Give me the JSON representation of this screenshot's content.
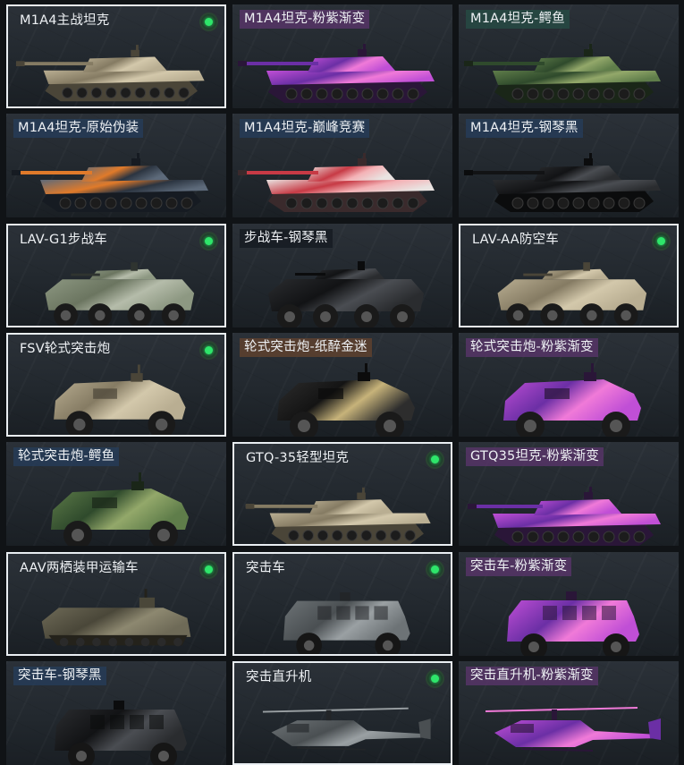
{
  "vehicles": [
    {
      "name": "M1A4主战坦克",
      "tag": "none",
      "selected": true,
      "owned": true,
      "kind": "tank",
      "skin": "desert"
    },
    {
      "name": "M1A4坦克-粉紫渐变",
      "tag": "purple",
      "selected": false,
      "owned": false,
      "kind": "tank",
      "skin": "pinkpurple"
    },
    {
      "name": "M1A4坦克-鳄鱼",
      "tag": "teal",
      "selected": false,
      "owned": false,
      "kind": "tank",
      "skin": "crocodile"
    },
    {
      "name": "M1A4坦克-原始伪装",
      "tag": "navy",
      "selected": false,
      "owned": false,
      "kind": "tank",
      "skin": "orangecamo"
    },
    {
      "name": "M1A4坦克-巅峰竞赛",
      "tag": "navy",
      "selected": false,
      "owned": false,
      "kind": "tank",
      "skin": "redwhite"
    },
    {
      "name": "M1A4坦克-钢琴黑",
      "tag": "navy",
      "selected": false,
      "owned": false,
      "kind": "tank",
      "skin": "black"
    },
    {
      "name": "LAV-G1步战车",
      "tag": "none",
      "selected": true,
      "owned": true,
      "kind": "ifv",
      "skin": "green"
    },
    {
      "name": "步战车-钢琴黑",
      "tag": "dark",
      "selected": false,
      "owned": false,
      "kind": "ifv",
      "skin": "black"
    },
    {
      "name": "LAV-AA防空车",
      "tag": "none",
      "selected": true,
      "owned": true,
      "kind": "ifv",
      "skin": "desert"
    },
    {
      "name": "FSV轮式突击炮",
      "tag": "none",
      "selected": true,
      "owned": true,
      "kind": "armored",
      "skin": "desert"
    },
    {
      "name": "轮式突击炮-纸醉金迷",
      "tag": "brown",
      "selected": false,
      "owned": false,
      "kind": "armored",
      "skin": "blackgold"
    },
    {
      "name": "轮式突击炮-粉紫渐变",
      "tag": "purple",
      "selected": false,
      "owned": false,
      "kind": "armored",
      "skin": "pinkpurple"
    },
    {
      "name": "轮式突击炮-鳄鱼",
      "tag": "navy",
      "selected": false,
      "owned": false,
      "kind": "armored",
      "skin": "crocodile"
    },
    {
      "name": "GTQ-35轻型坦克",
      "tag": "none",
      "selected": true,
      "owned": true,
      "kind": "lighttank",
      "skin": "desert"
    },
    {
      "name": "GTQ35坦克-粉紫渐变",
      "tag": "purple",
      "selected": false,
      "owned": false,
      "kind": "lighttank",
      "skin": "pinkpurple"
    },
    {
      "name": "AAV两栖装甲运输车",
      "tag": "none",
      "selected": true,
      "owned": true,
      "kind": "aav",
      "skin": "olive"
    },
    {
      "name": "突击车",
      "tag": "none",
      "selected": true,
      "owned": true,
      "kind": "assault",
      "skin": "grey"
    },
    {
      "name": "突击车-粉紫渐变",
      "tag": "purple",
      "selected": false,
      "owned": false,
      "kind": "assault",
      "skin": "pinkpurple"
    },
    {
      "name": "突击车-钢琴黑",
      "tag": "navy",
      "selected": false,
      "owned": false,
      "kind": "assault",
      "skin": "black"
    },
    {
      "name": "突击直升机",
      "tag": "none",
      "selected": true,
      "owned": true,
      "kind": "heli",
      "skin": "grey"
    },
    {
      "name": "突击直升机-粉紫渐变",
      "tag": "purple",
      "selected": false,
      "owned": false,
      "kind": "heli",
      "skin": "pinkpurple"
    }
  ],
  "colors": {
    "owned_indicator": "#2ee56a",
    "selected_border": "#e9eef2"
  }
}
